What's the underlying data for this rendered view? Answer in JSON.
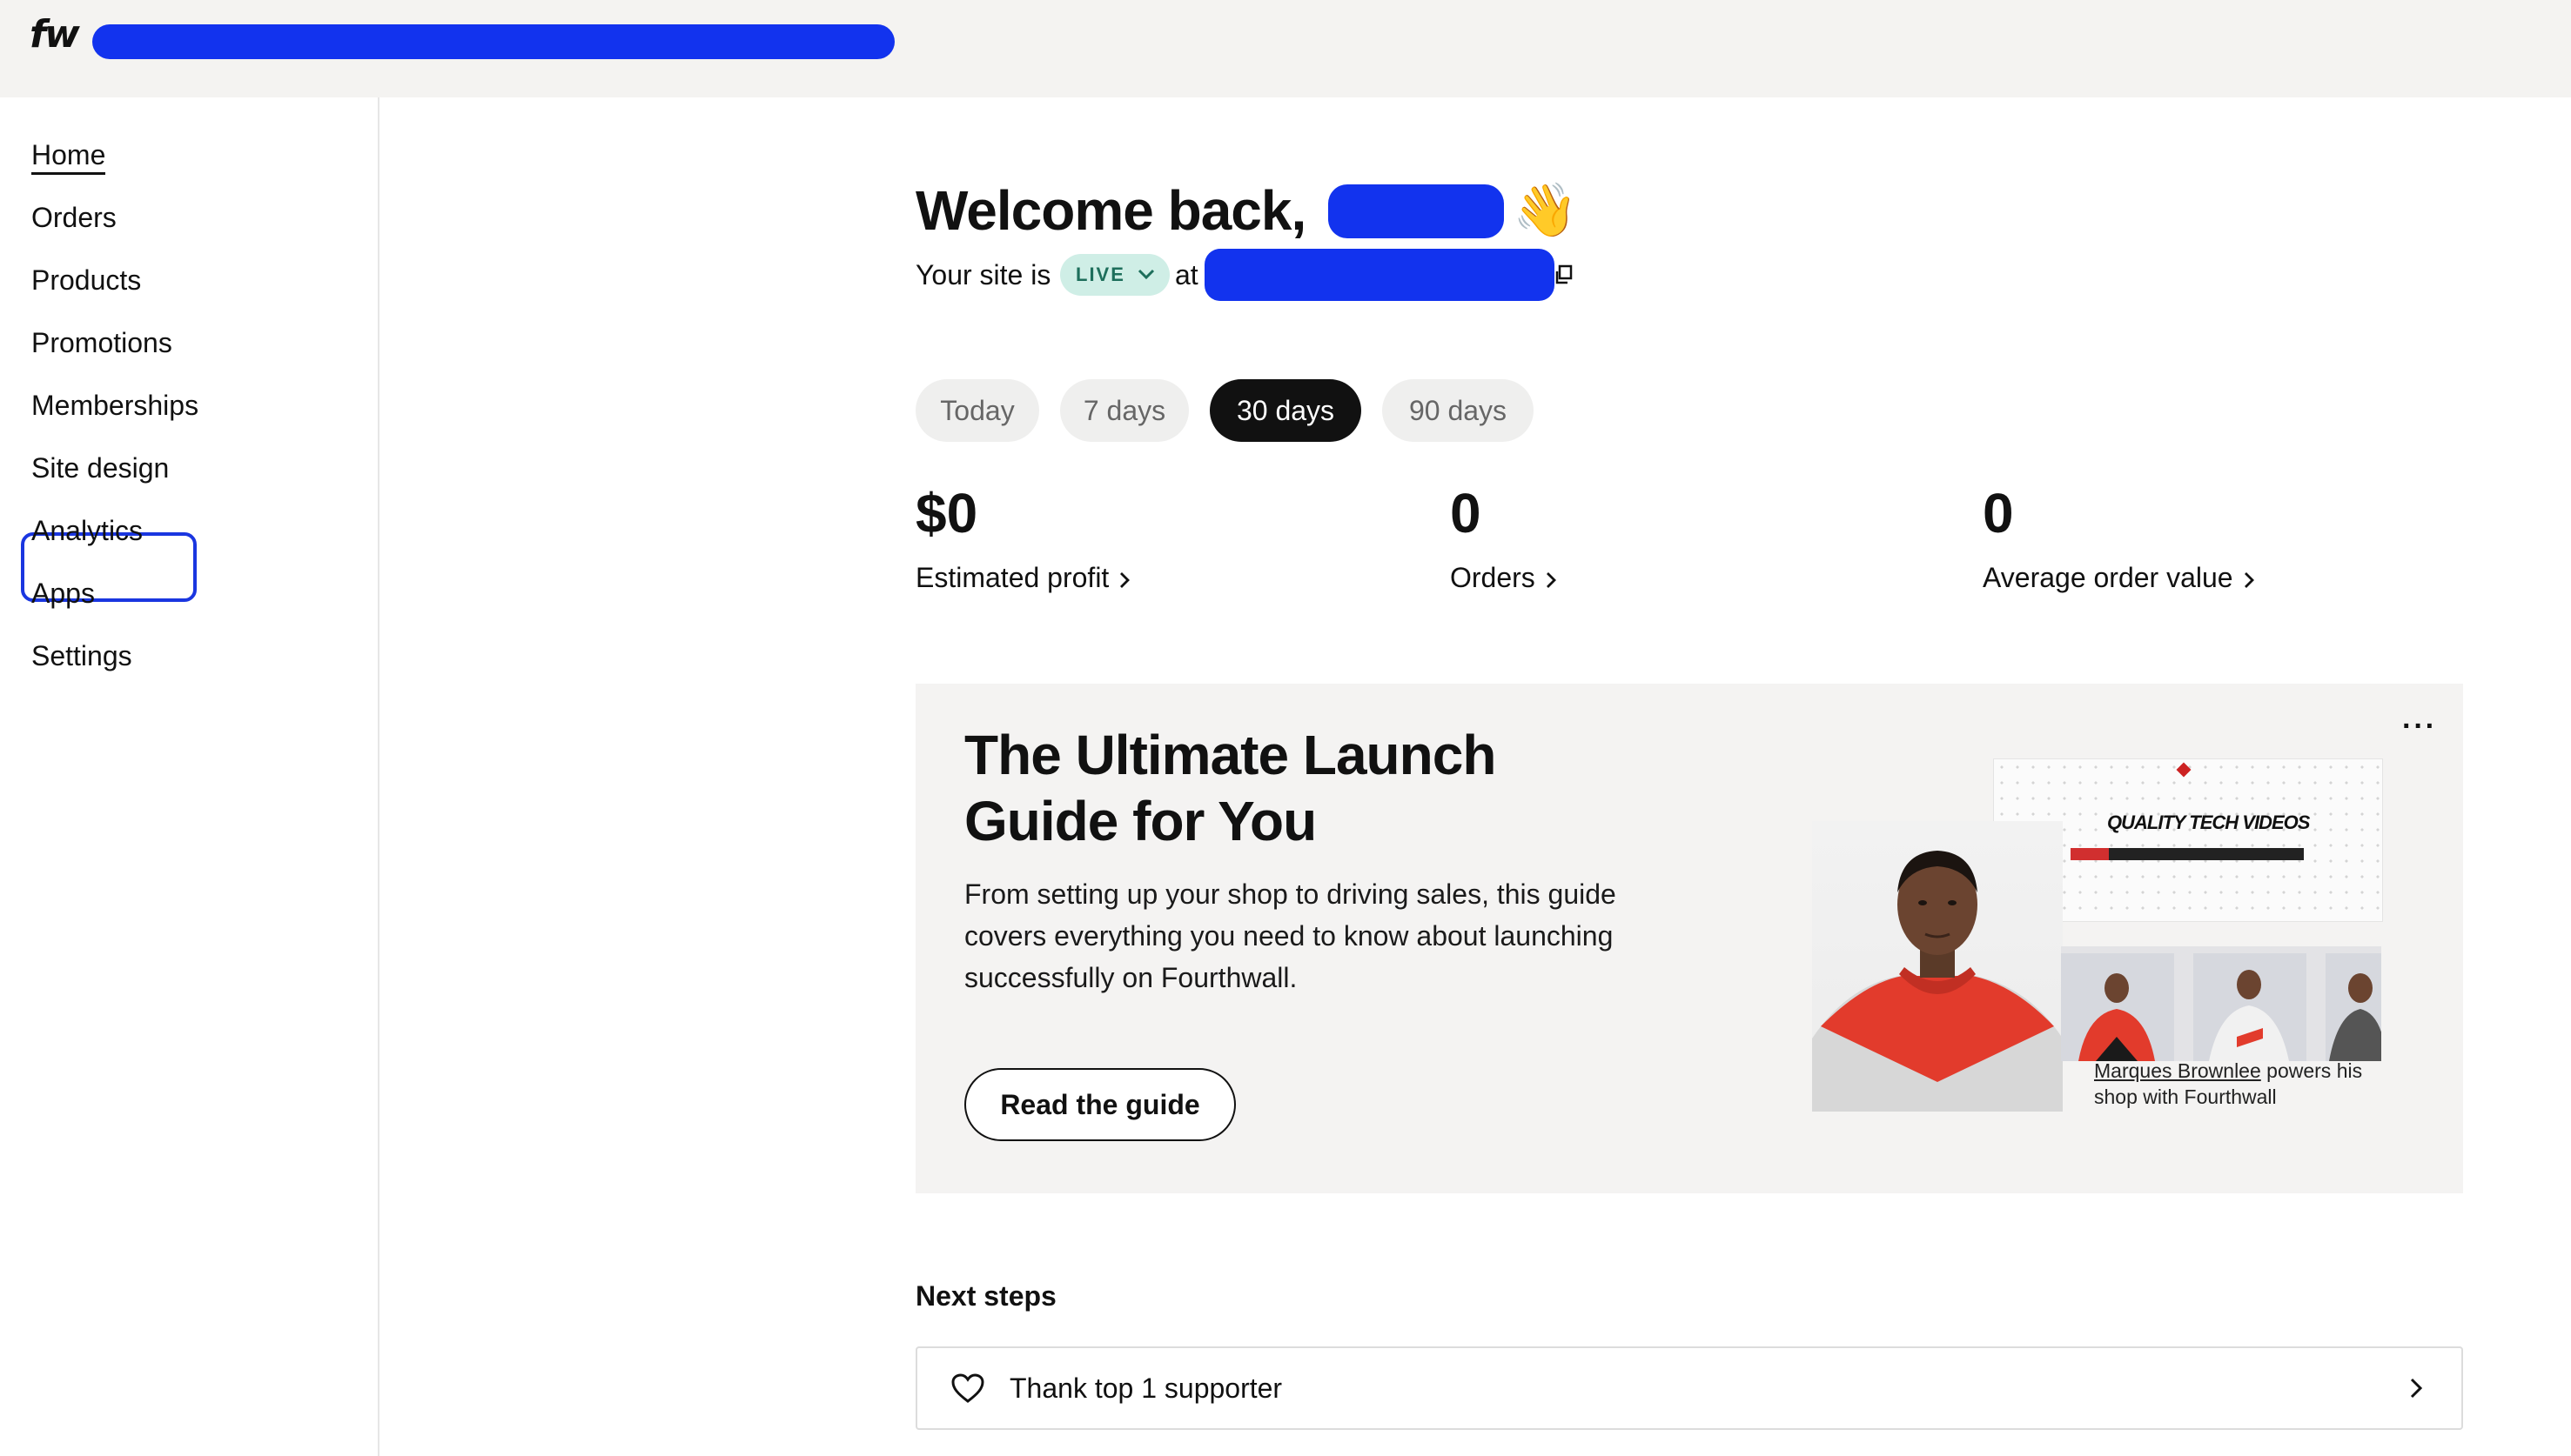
{
  "app": {
    "logo_text": "fw"
  },
  "sidebar": {
    "items": [
      {
        "label": "Home"
      },
      {
        "label": "Orders"
      },
      {
        "label": "Products"
      },
      {
        "label": "Promotions"
      },
      {
        "label": "Memberships"
      },
      {
        "label": "Site design"
      },
      {
        "label": "Analytics"
      },
      {
        "label": "Apps"
      },
      {
        "label": "Settings"
      }
    ]
  },
  "header": {
    "welcome": "Welcome back,",
    "wave_emoji": "👋",
    "site_prefix": "Your site is",
    "status_badge": "LIVE",
    "site_at": "at"
  },
  "date_ranges": {
    "today": "Today",
    "d7": "7 days",
    "d30": "30 days",
    "d90": "90 days",
    "selected": "30 days"
  },
  "stats": [
    {
      "value": "$0",
      "label": "Estimated profit"
    },
    {
      "value": "0",
      "label": "Orders"
    },
    {
      "value": "0",
      "label": "Average order value"
    }
  ],
  "guide": {
    "title": "The Ultimate Launch Guide for You",
    "description": "From setting up your shop to driving sales, this guide covers everything you need to know about launching successfully on Fourthwall.",
    "button": "Read the guide",
    "more": "···",
    "preview_title": "QUALITY TECH VIDEOS",
    "caption_name": "Marques Brownlee",
    "caption_rest": " powers his shop with Fourthwall"
  },
  "next_steps": {
    "title": "Next steps",
    "items": [
      {
        "label": "Thank top 1 supporter"
      }
    ]
  },
  "colors": {
    "accent_focus": "#1a36e0",
    "redaction": "#1233ee",
    "live_badge_bg": "#cfeee6",
    "live_badge_text": "#1d6e5b"
  }
}
